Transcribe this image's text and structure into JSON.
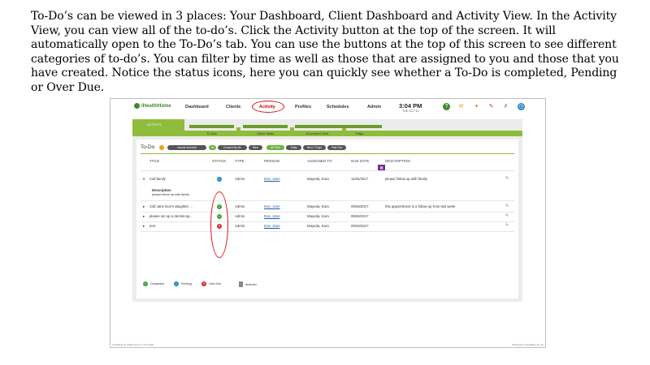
{
  "intro": "To-Do’s can be viewed in 3 places: Your Dashboard, Client Dashboard and Activity View. In the Activity View, you can view all of the to-do’s. Click the Activity button at the top of the screen. It will automatically open to the To-Do’s tab. You can use the buttons at the top of this screen to see different categories of to-do’s. You can filter by time as well as those that are assigned to you and those that you have created. Notice the status icons, here you can quickly see whether a To-Do is completed, Pending or Over Due.",
  "app": {
    "logo": "iHealthHome",
    "nav": [
      "Dashboard",
      "Clients",
      "Activity",
      "Profiles",
      "Schedules",
      "Admin"
    ],
    "time": "3:04 PM",
    "date": "TUE OCT 31",
    "accent": "#8fbc3a",
    "icons": [
      "help-icon",
      "mail-icon",
      "megaphone-icon",
      "pencil-icon",
      "pin-icon",
      "clock-icon"
    ]
  },
  "activity": {
    "section": "ACTIVITY",
    "tabs": [
      "To-Dos",
      "Client Tasks",
      "Document Time",
      "Flags"
    ]
  },
  "todo": {
    "title": "To-Do",
    "filters": [
      "Include Archived",
      "All",
      "Created By Me",
      "Mine",
      "All Time",
      "Today",
      "Next 7 Days",
      "Past Due"
    ],
    "headers": [
      "TITLE",
      "STATUS",
      "TYPE",
      "PERSON",
      "ASSIGNED TO",
      "DUE DATE",
      "DESCRIPTION"
    ],
    "rows": [
      {
        "title": "Call family",
        "status": "pending",
        "type": "Admin",
        "person": "Doe, Jane",
        "assigned": "Mayeda, Kara",
        "due": "11/04/2017",
        "desc": "please follow up with family"
      },
      {
        "title": "Call Jane Doe's daughter ...",
        "status": "completed",
        "type": "Admin",
        "person": "Doe, Jane",
        "assigned": "Mayeda, Kara",
        "due": "09/26/2017",
        "desc": "this appointment is a follow up from last week"
      },
      {
        "title": "please set up a dentist ap...",
        "status": "completed",
        "type": "Admin",
        "person": "Doe, Jane",
        "assigned": "Mayeda, Kara",
        "due": "09/26/2017",
        "desc": ""
      },
      {
        "title": "test",
        "status": "overdue",
        "type": "Admin",
        "person": "Doe, Jane",
        "assigned": "Mayeda, Kara",
        "due": "09/25/2017",
        "desc": ""
      }
    ],
    "expanded": {
      "label": "Description",
      "text": "please follow up with family"
    },
    "legend": [
      "Completed",
      "Pending",
      "Over Due",
      "Archived"
    ]
  },
  "footer": {
    "left": "iHealthHome CMS Version 1.5.0 2018",
    "right": "Powered by iHealthHome.net"
  }
}
